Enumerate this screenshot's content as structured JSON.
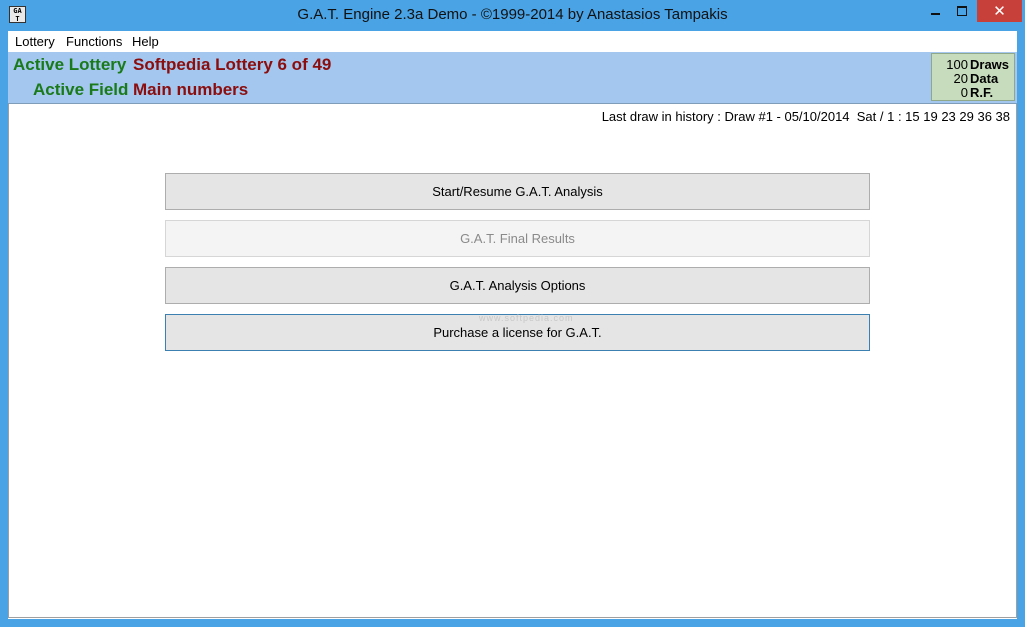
{
  "window": {
    "title": "G.A.T. Engine 2.3a Demo  - ©1999-2014 by Anastasios Tampakis",
    "icon_text": "GA T",
    "controls": {
      "minimize": "minimize-icon",
      "maximize": "maximize-icon",
      "close": "✕"
    }
  },
  "menubar": {
    "items": [
      {
        "label": "Lottery"
      },
      {
        "label": "Functions"
      },
      {
        "label": "Help"
      }
    ]
  },
  "infobar": {
    "active_lottery_label": "Active Lottery",
    "active_lottery_value": "Softpedia Lottery 6 of 49",
    "active_field_label": "Active Field",
    "active_field_value": "Main numbers",
    "stats": [
      {
        "value": "100",
        "label": "Draws"
      },
      {
        "value": "20",
        "label": "Data"
      },
      {
        "value": "0",
        "label": "R.F."
      }
    ],
    "colors": {
      "label": "#1a7a1a",
      "value": "#8b0d0d",
      "bar": "#a3c7ee",
      "stats_bg": "#c7dcbc"
    }
  },
  "main": {
    "last_draw": "Last draw in history : Draw #1 - 05/10/2014  Sat / 1 : 15 19 23 29 36 38",
    "buttons": [
      {
        "label": "Start/Resume G.A.T. Analysis",
        "enabled": true
      },
      {
        "label": "G.A.T. Final Results",
        "enabled": false
      },
      {
        "label": "G.A.T. Analysis Options",
        "enabled": true
      },
      {
        "label": "Purchase a license for G.A.T.",
        "enabled": true,
        "focused": true
      }
    ],
    "watermark": "www.softpedia.com"
  }
}
